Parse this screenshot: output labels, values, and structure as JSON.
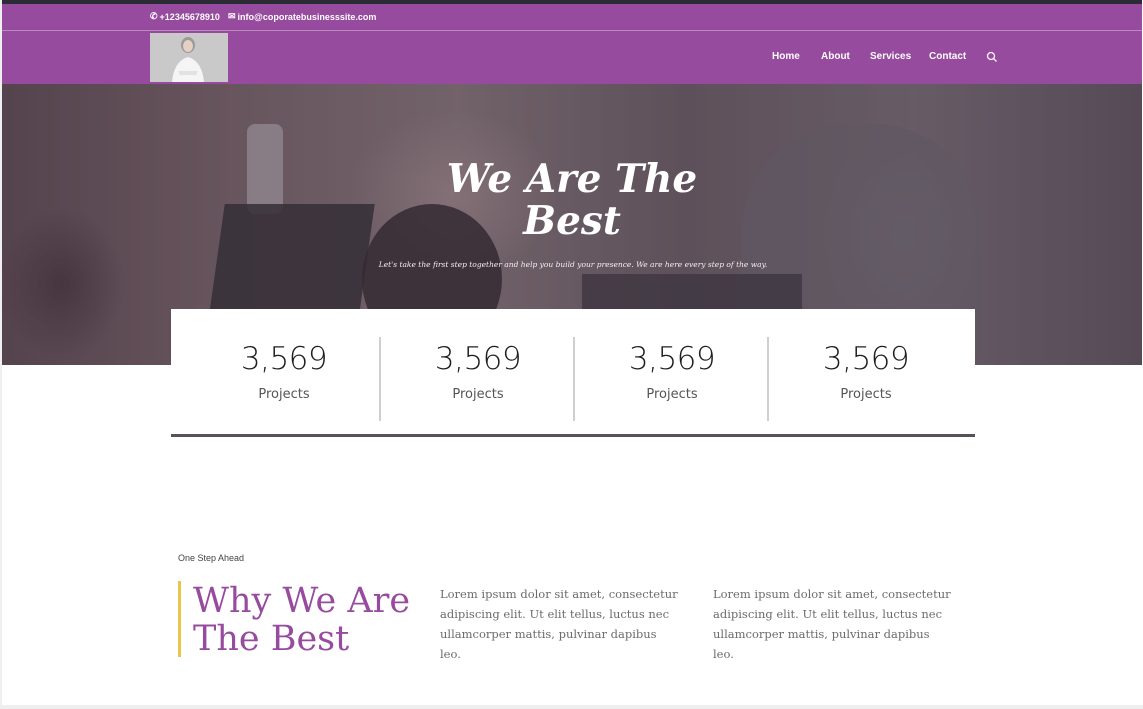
{
  "topbar": {
    "phone": "+12345678910",
    "email": "info@coporatebusinesssite.com"
  },
  "nav": {
    "items": [
      {
        "label": "Home"
      },
      {
        "label": "About"
      },
      {
        "label": "Services"
      },
      {
        "label": "Contact"
      }
    ],
    "search_icon": "search-icon"
  },
  "hero": {
    "title_line1": "We Are The",
    "title_line2": "Best",
    "subtitle": "Let's take the first step together and help you build your presence. We are here every step of the way."
  },
  "stats": [
    {
      "value": "3,569",
      "label": "Projects"
    },
    {
      "value": "3,569",
      "label": "Projects"
    },
    {
      "value": "3,569",
      "label": "Projects"
    },
    {
      "value": "3,569",
      "label": "Projects"
    }
  ],
  "why": {
    "eyebrow": "One Step Ahead",
    "title_line1": "Why We Are",
    "title_line2": "The Best",
    "col1": "Lorem ipsum dolor sit amet, consectetur adipiscing elit. Ut elit tellus, luctus nec ullamcorper mattis, pulvinar dapibus leo.",
    "col2": "Lorem ipsum dolor sit amet, consectetur adipiscing elit. Ut elit tellus, luctus nec ullamcorper mattis, pulvinar dapibus leo."
  },
  "colors": {
    "brand_purple": "#974b9f",
    "accent_yellow": "#e7c64a",
    "dark_line": "#565257"
  }
}
